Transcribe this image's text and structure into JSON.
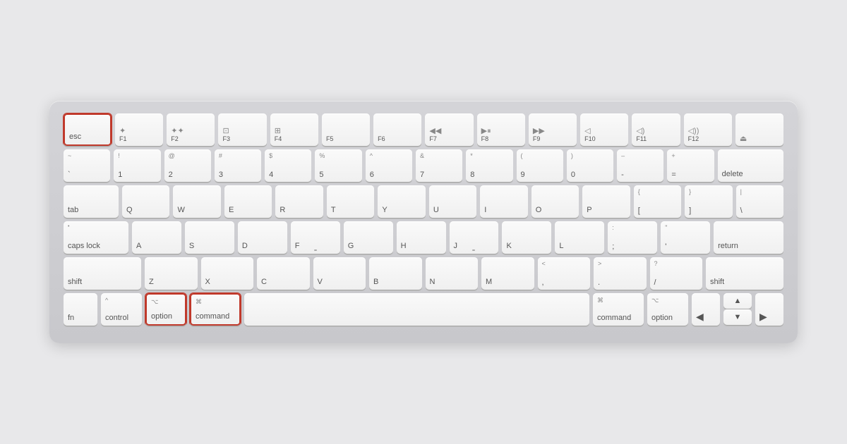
{
  "keyboard": {
    "rows": {
      "fn_row": {
        "keys": [
          {
            "id": "esc",
            "label": "esc",
            "highlighted": true
          },
          {
            "id": "f1",
            "icon": "☀",
            "sub": "F1"
          },
          {
            "id": "f2",
            "icon": "☀",
            "sub": "F2"
          },
          {
            "id": "f3",
            "icon": "⊞",
            "sub": "F3"
          },
          {
            "id": "f4",
            "icon": "⊞",
            "sub": "F4"
          },
          {
            "id": "f5",
            "sub": "F5"
          },
          {
            "id": "f6",
            "sub": "F6"
          },
          {
            "id": "f7",
            "icon": "⏮",
            "sub": "F7"
          },
          {
            "id": "f8",
            "icon": "⏯",
            "sub": "F8"
          },
          {
            "id": "f9",
            "icon": "⏭",
            "sub": "F9"
          },
          {
            "id": "f10",
            "icon": "🔇",
            "sub": "F10"
          },
          {
            "id": "f11",
            "icon": "🔉",
            "sub": "F11"
          },
          {
            "id": "f12",
            "icon": "🔊",
            "sub": "F12"
          },
          {
            "id": "eject",
            "icon": "⏏"
          }
        ]
      }
    },
    "highlighted_keys": [
      "esc",
      "option-left",
      "command-left"
    ]
  }
}
